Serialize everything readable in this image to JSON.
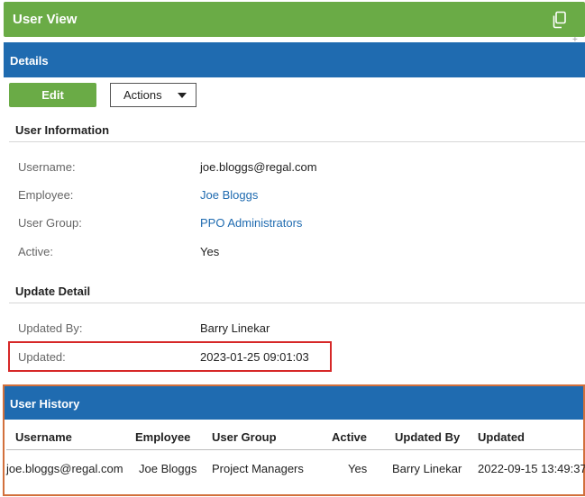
{
  "header": {
    "title": "User View",
    "copy_icon": "copy-icon"
  },
  "details": {
    "title": "Details",
    "edit_label": "Edit",
    "actions_label": "Actions"
  },
  "user_info": {
    "title": "User Information",
    "rows": [
      {
        "label": "Username:",
        "value": "joe.bloggs@regal.com"
      },
      {
        "label": "Employee:",
        "value": "Joe Bloggs"
      },
      {
        "label": "User Group:",
        "value": "PPO Administrators"
      },
      {
        "label": "Active:",
        "value": "Yes"
      }
    ]
  },
  "update_detail": {
    "title": "Update Detail",
    "rows": [
      {
        "label": "Updated By:",
        "value": "Barry Linekar"
      },
      {
        "label": "Updated:",
        "value": "2023-01-25 09:01:03"
      }
    ]
  },
  "history": {
    "title": "User History",
    "columns": [
      "Username",
      "Employee",
      "User Group",
      "Active",
      "Updated By",
      "Updated"
    ],
    "rows": [
      [
        "joe.bloggs@regal.com",
        "Joe Bloggs",
        "Project Managers",
        "Yes",
        "Barry Linekar",
        "2022-09-15 13:49:37"
      ]
    ]
  },
  "colors": {
    "green": "#6aab46",
    "blue": "#1f6bb0",
    "highlight_red": "#d62828",
    "highlight_orange": "#d2703c",
    "link": "#1f6bb0"
  }
}
